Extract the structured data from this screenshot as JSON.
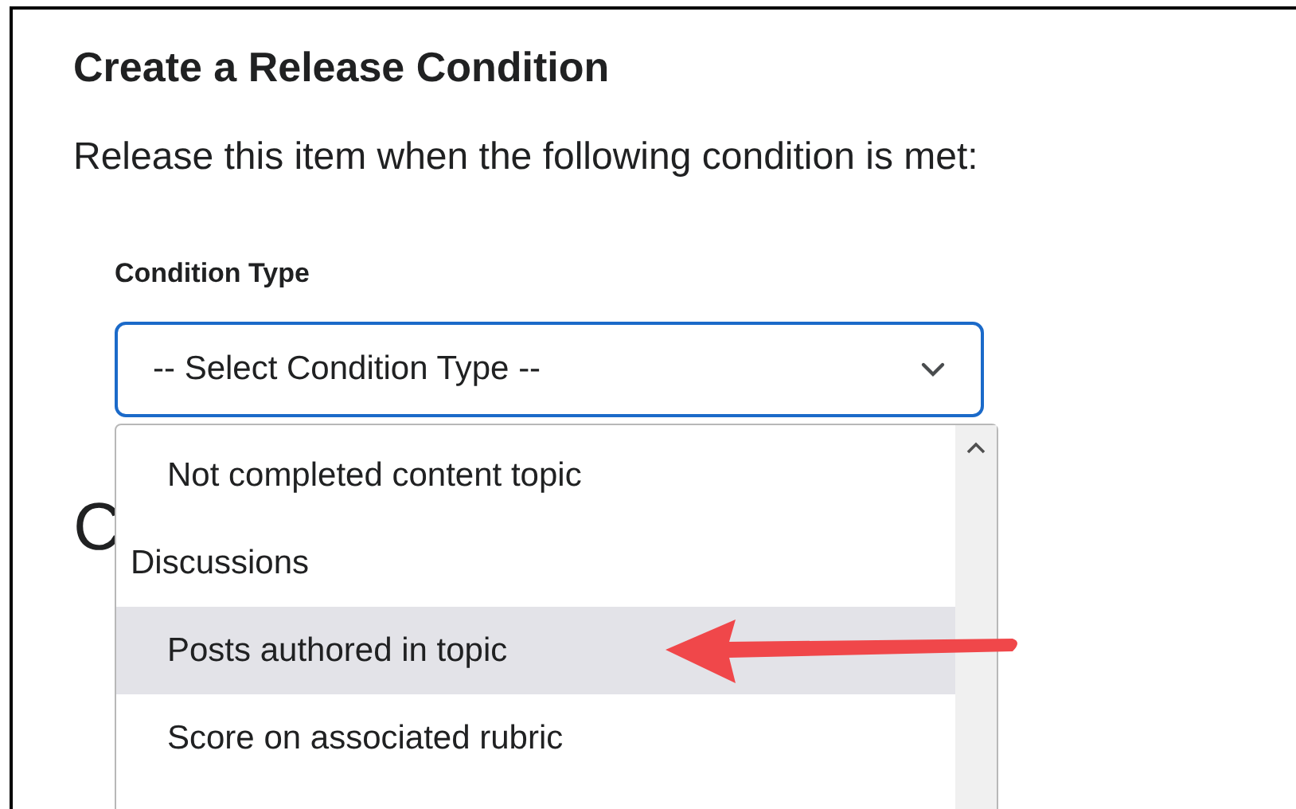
{
  "dialog": {
    "title": "Create a Release Condition",
    "description": "Release this item when the following condition is met:"
  },
  "condition_type": {
    "label": "Condition Type",
    "value": "-- Select Condition Type --",
    "expanded": true
  },
  "covered_heading": "C",
  "dropdown_options": [
    {
      "kind": "option",
      "label": "Not completed content topic",
      "selected": false
    },
    {
      "kind": "group",
      "label": "Discussions"
    },
    {
      "kind": "option",
      "label": "Posts authored in topic",
      "selected": true
    },
    {
      "kind": "option",
      "label": "Score on associated rubric",
      "selected": false
    }
  ]
}
